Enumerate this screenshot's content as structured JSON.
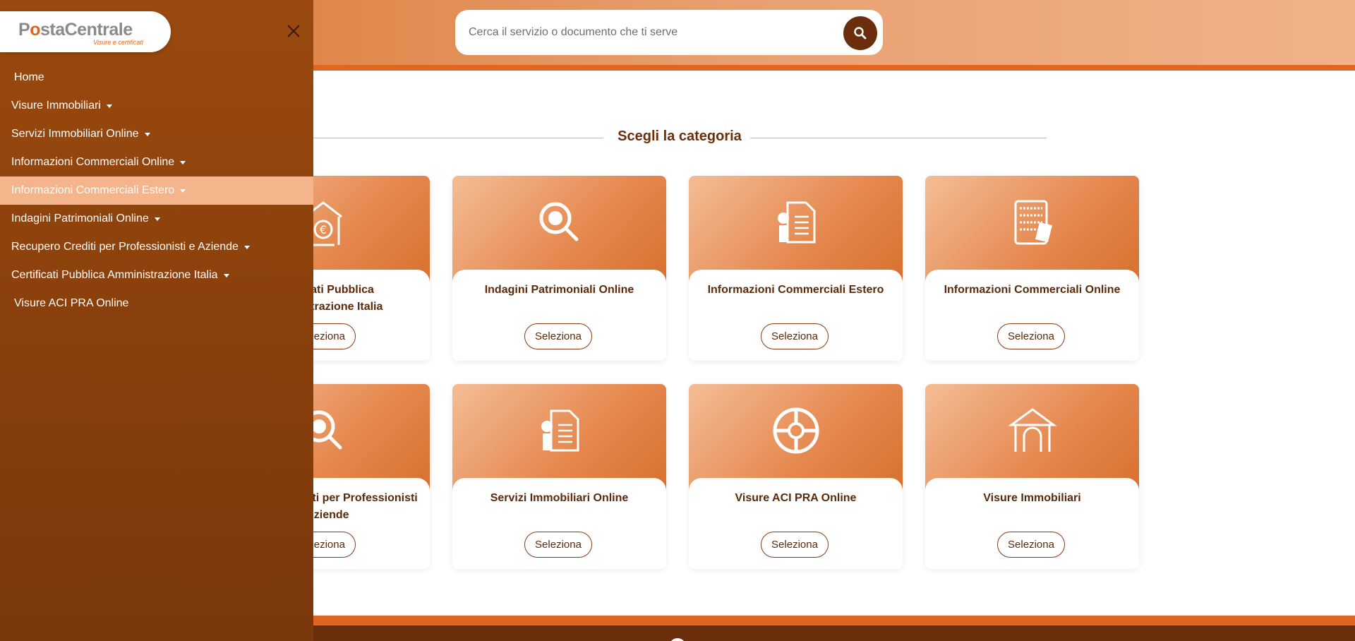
{
  "header": {
    "search_placeholder": "Cerca il servizio o documento che ti serve"
  },
  "main": {
    "section_title": "Scegli la categoria",
    "cards": [
      {
        "title_line1": "Certificati Pubblica",
        "title_line2": "Amministrazione Italia",
        "button": "Seleziona",
        "icon": "bank-euro-icon"
      },
      {
        "title_line1": "Indagini Patrimoniali Online",
        "title_line2": "",
        "button": "Seleziona",
        "icon": "magnifier-icon"
      },
      {
        "title_line1": "Informazioni Commerciali Estero",
        "title_line2": "",
        "button": "Seleziona",
        "icon": "document-certificate-icon"
      },
      {
        "title_line1": "Informazioni Commerciali Online",
        "title_line2": "",
        "button": "Seleziona",
        "icon": "server-document-icon"
      },
      {
        "title_line1": "Recupero Crediti per Professionisti",
        "title_line2": "e Aziende",
        "button": "Seleziona",
        "icon": "magnifier-icon"
      },
      {
        "title_line1": "Servizi Immobiliari Online",
        "title_line2": "",
        "button": "Seleziona",
        "icon": "document-certificate-icon"
      },
      {
        "title_line1": "Visure ACI PRA Online",
        "title_line2": "",
        "button": "Seleziona",
        "icon": "steering-wheel-icon"
      },
      {
        "title_line1": "Visure Immobiliari",
        "title_line2": "",
        "button": "Seleziona",
        "icon": "house-icon"
      }
    ]
  },
  "sidebar": {
    "logo": {
      "brand_a": "P",
      "brand_b": "o",
      "brand_c": "sta",
      "brand_d": "Centrale",
      "tagline": "Visure e certificati"
    },
    "items": [
      {
        "label": "Home",
        "dropdown": false
      },
      {
        "label": "Visure Immobiliari",
        "dropdown": true
      },
      {
        "label": "Servizi Immobiliari Online",
        "dropdown": true
      },
      {
        "label": "Informazioni Commerciali Online",
        "dropdown": true
      },
      {
        "label": "Informazioni Commerciali Estero",
        "dropdown": true,
        "active": true
      },
      {
        "label": "Indagini Patrimoniali Online",
        "dropdown": true
      },
      {
        "label": "Recupero Crediti per Professionisti e Aziende",
        "dropdown": true
      },
      {
        "label": "Certificati Pubblica Amministrazione Italia",
        "dropdown": true
      },
      {
        "label": "Visure ACI PRA Online",
        "dropdown": false
      }
    ]
  },
  "footer": {
    "social_icon": "facebook-icon",
    "social_glyph": "f"
  },
  "colors": {
    "brand_dark": "#6b2e0c",
    "brand_orange": "#e0651f",
    "sidebar": "#8a400c",
    "active_item": "#f4b48c"
  }
}
